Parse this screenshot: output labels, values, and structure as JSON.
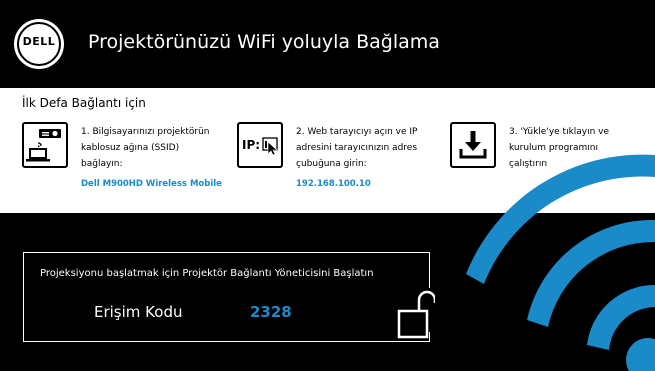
{
  "header": {
    "logo_text": "DELL",
    "title": "Projektörünüzü WiFi yoluyla Bağlama"
  },
  "first_time": {
    "heading": "İlk Defa Bağlantı için",
    "steps": [
      {
        "icon": "projector-laptop-icon",
        "text_lines": [
          "1. Bilgisayarınızı projektörün",
          "kablosuz ağına (SSID)",
          "bağlayın:"
        ],
        "value": "Dell M900HD Wireless Mobile"
      },
      {
        "icon": "ip-address-icon",
        "icon_label": "IP:",
        "text_lines": [
          "2. Web tarayıcıyı açın ve IP",
          "adresini tarayıcınızın adres",
          "çubuğuna girin:"
        ],
        "value": "192.168.100.10"
      },
      {
        "icon": "download-icon",
        "text_lines": [
          "3. 'Yükle'ye tıklayın ve",
          "kurulum programını",
          "çalıştırın"
        ]
      }
    ]
  },
  "launch_panel": {
    "heading": "Projeksiyonu başlatmak için Projektör Bağlantı Yöneticisini Başlatın",
    "access_code_label": "Erişim Kodu",
    "access_code": "2328",
    "lock_icon": "unlocked-padlock-icon"
  },
  "decoration": {
    "wifi_icon": "wifi-arcs-icon",
    "accent_color": "#1a8ac8"
  }
}
